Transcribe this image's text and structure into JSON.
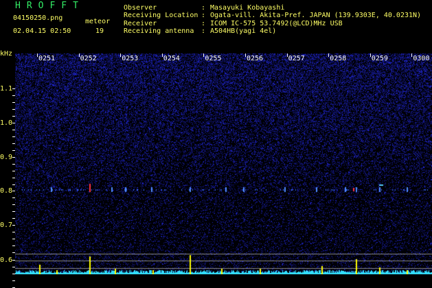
{
  "program": "HROFFT",
  "file": {
    "name": "04150250.png",
    "datetime": "02.04.15 02:50",
    "meteor_label": "meteor",
    "meteor_count": "19"
  },
  "header": [
    {
      "label": "Observer",
      "value": "Masayuki Kobayashi"
    },
    {
      "label": "Receiving Location",
      "value": "Ogata-vill. Akita-Pref. JAPAN (139.9303E, 40.0231N)"
    },
    {
      "label": "Receiver",
      "value": "ICOM IC-575 53.7492(@LCD)MHz USB"
    },
    {
      "label": "Receiving antenna",
      "value": "A504HB(yagi 4el)"
    }
  ],
  "axis": {
    "unit": "kHz",
    "y_ticks": [
      "1.1",
      "1.0",
      "0.9",
      "0.8",
      "0.7",
      "0.6"
    ],
    "time_ticks": [
      "0251",
      "0252",
      "0253",
      "0254",
      "0255",
      "0256",
      "0257",
      "0258",
      "0259",
      "0300"
    ]
  },
  "colors": {
    "background": "#000000",
    "text": "#ffff66",
    "logo": "#33ee66",
    "noise": "#1a22cc",
    "level_trace": "#33ddff",
    "ping_marker": "#ffff00"
  }
}
